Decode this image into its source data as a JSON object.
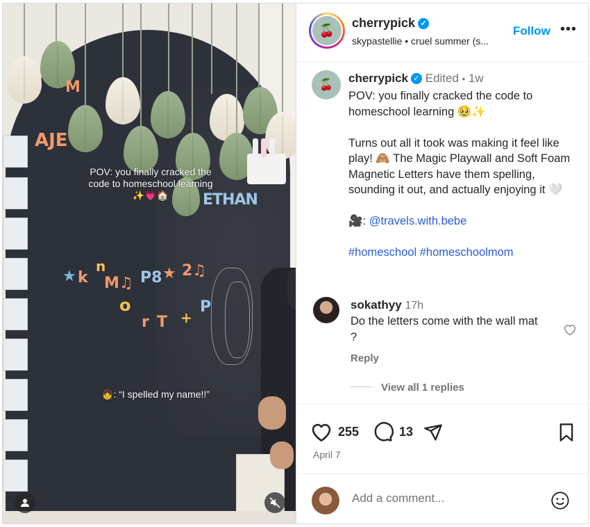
{
  "post": {
    "username": "cherrypick",
    "audio_line": "skypastellie • cruel summer (s...",
    "follow_label": "Follow",
    "more_label": "•••"
  },
  "video": {
    "overlay_top": "POV: you finally cracked the code to homeschool learning ✨💗🏠",
    "overlay_bottom": "👧: “I spelled my name!!”",
    "magnet_name": "ETHAN",
    "magnet_letters_left": "AJE",
    "magnet_letters_top": "M",
    "magnet_row1": "k",
    "magnet_row2": "M♫",
    "magnet_row3": "P8",
    "magnet_row4": "2♫",
    "magnet_row5": "o",
    "magnet_row6": "r",
    "magnet_row7": "T",
    "magnet_row8": "P",
    "magnet_row9": "n"
  },
  "caption": {
    "username": "cherrypick",
    "edited": "Edited",
    "dot": "•",
    "time": "1w",
    "para1": "POV: you finally cracked the code to homeschool learning 🥹✨",
    "para2": "Turns out all it took was making it feel like play! 🙈 The Magic Playwall and Soft Foam Magnetic Letters have them spelling, sounding it out, and actually enjoying it 🤍",
    "credit_prefix": "🎥: ",
    "credit_link": "@travels.with.bebe",
    "hashtags": "#homeschool #homeschoolmom"
  },
  "comment": {
    "username": "sokathyy",
    "time": "17h",
    "text": "Do the letters come with the wall mat ?",
    "reply_label": "Reply",
    "view_replies": "View all 1 replies"
  },
  "actions": {
    "likes": "255",
    "comments": "13",
    "date": "April 7"
  },
  "add_comment": {
    "placeholder": "Add a comment..."
  },
  "icons": {
    "like": "heart-icon",
    "comment": "comment-icon",
    "share": "share-icon",
    "save": "bookmark-icon",
    "emoji": "emoji-icon",
    "mute": "muted-icon",
    "tag": "user-tag-icon"
  },
  "colors": {
    "accent": "#0095f6",
    "link": "#2a5bd7",
    "muted": "#737373"
  }
}
